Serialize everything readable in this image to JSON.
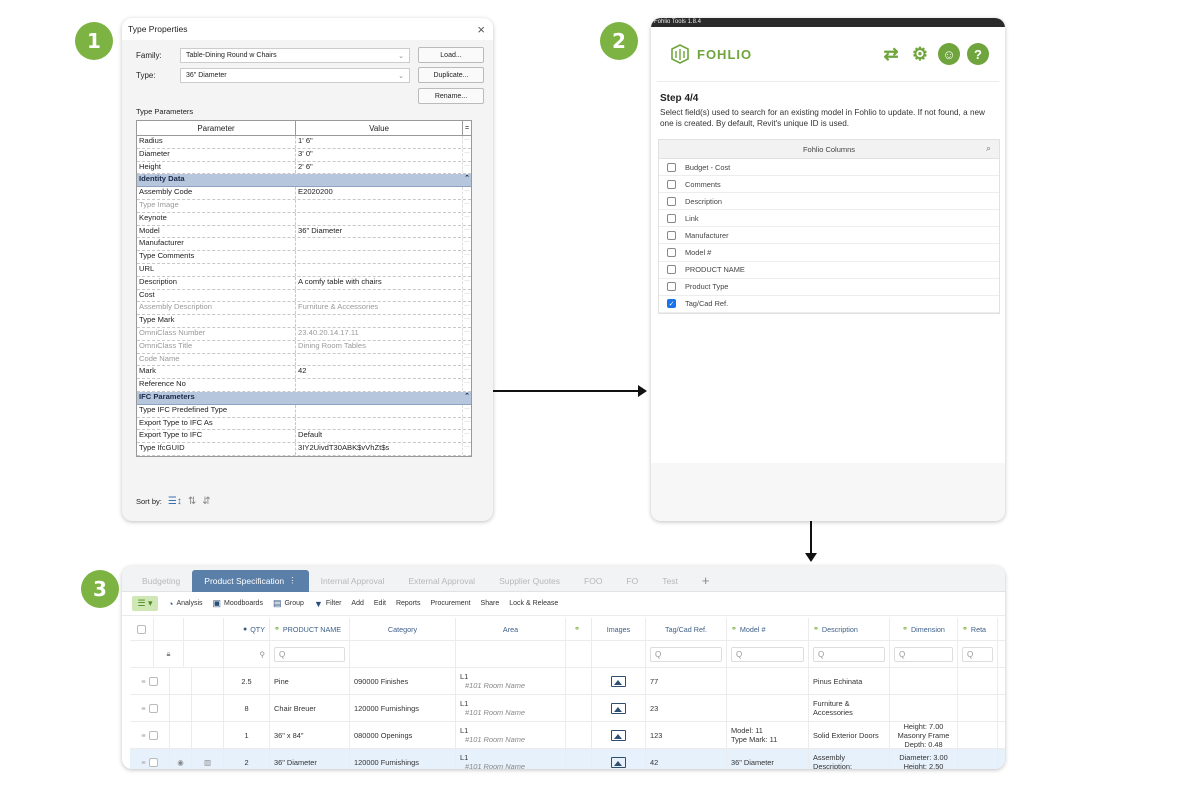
{
  "badges": [
    "1",
    "2",
    "3"
  ],
  "panel1": {
    "title": "Type Properties",
    "close": "×",
    "family_label": "Family:",
    "family_value": "Table-Dining Round w Chairs",
    "type_label": "Type:",
    "type_value": "36\" Diameter",
    "load_button": "Load...",
    "duplicate_button": "Duplicate...",
    "rename_button": "Rename...",
    "section_label": "Type Parameters",
    "col_parameter": "Parameter",
    "col_value": "Value",
    "col_sym": "=",
    "rows": [
      {
        "param": "Radius",
        "value": "1'  6\"",
        "kind": "row"
      },
      {
        "param": "Diameter",
        "value": "3'  0\"",
        "kind": "row"
      },
      {
        "param": "Height",
        "value": "2'  6\"",
        "kind": "row"
      },
      {
        "param": "Identity Data",
        "value": "",
        "kind": "group"
      },
      {
        "param": "Assembly Code",
        "value": "E2020200",
        "kind": "row"
      },
      {
        "param": "Type Image",
        "value": "",
        "kind": "dim"
      },
      {
        "param": "Keynote",
        "value": "",
        "kind": "row"
      },
      {
        "param": "Model",
        "value": "36\" Diameter",
        "kind": "row"
      },
      {
        "param": "Manufacturer",
        "value": "",
        "kind": "row"
      },
      {
        "param": "Type Comments",
        "value": "",
        "kind": "row"
      },
      {
        "param": "URL",
        "value": "",
        "kind": "row"
      },
      {
        "param": "Description",
        "value": "A comfy table with chairs",
        "kind": "row"
      },
      {
        "param": "Cost",
        "value": "",
        "kind": "row"
      },
      {
        "param": "Assembly Description",
        "value": "Furniture & Accessories",
        "kind": "dim"
      },
      {
        "param": "Type Mark",
        "value": "",
        "kind": "row"
      },
      {
        "param": "OmniClass Number",
        "value": "23.40.20.14.17.11",
        "kind": "dim"
      },
      {
        "param": "OmniClass Title",
        "value": "Dining Room Tables",
        "kind": "dim"
      },
      {
        "param": "Code Name",
        "value": "",
        "kind": "dim"
      },
      {
        "param": "Mark",
        "value": "42",
        "kind": "row"
      },
      {
        "param": "Reference No",
        "value": "",
        "kind": "row"
      },
      {
        "param": "IFC Parameters",
        "value": "",
        "kind": "group"
      },
      {
        "param": "Type IFC Predefined Type",
        "value": "",
        "kind": "row"
      },
      {
        "param": "Export Type to IFC As",
        "value": "",
        "kind": "row"
      },
      {
        "param": "Export Type to IFC",
        "value": "Default",
        "kind": "row"
      },
      {
        "param": "Type IfcGUID",
        "value": "3IY2UivdT30ABK$vVhZt$s",
        "kind": "row"
      }
    ],
    "sort_label": "Sort by:"
  },
  "panel2": {
    "titlebar": "Fohlio Tools 1.8.4",
    "logo_text": "FOHLIO",
    "icons": [
      "refresh-icon",
      "gear-icon",
      "user-icon",
      "help-icon"
    ],
    "step": "Step 4/4",
    "description": "Select field(s) used to search for an existing model in Fohlio to update. If not found, a new one is created. By default, Revit's unique ID is used.",
    "list_header": "Fohlio Columns",
    "items": [
      {
        "label": "Budget - Cost",
        "checked": false
      },
      {
        "label": "Comments",
        "checked": false
      },
      {
        "label": "Description",
        "checked": false
      },
      {
        "label": "Link",
        "checked": false
      },
      {
        "label": "Manufacturer",
        "checked": false
      },
      {
        "label": "Model #",
        "checked": false
      },
      {
        "label": "PRODUCT NAME",
        "checked": false
      },
      {
        "label": "Product Type",
        "checked": false
      },
      {
        "label": "Tag/Cad Ref.",
        "checked": true
      }
    ]
  },
  "panel3": {
    "tabs": [
      "Budgeting",
      "Product Specification",
      "Internal Approval",
      "External Approval",
      "Supplier Quotes",
      "FOO",
      "FO",
      "Test",
      "+"
    ],
    "active_tab": "Product Specification",
    "toolbar": {
      "analysis": "Analysis",
      "moodboards": "Moodboards",
      "group": "Group",
      "filter": "Filter",
      "add": "Add",
      "edit": "Edit",
      "reports": "Reports",
      "procurement": "Procurement",
      "share": "Share",
      "lock": "Lock & Release"
    },
    "headers": {
      "qty": "QTY",
      "name": "PRODUCT NAME",
      "category": "Category",
      "area": "Area",
      "images": "Images",
      "tag": "Tag/Cad Ref.",
      "model": "Model #",
      "description": "Description",
      "dimension": "Dimension",
      "retail": "Reta"
    },
    "search_glyph": "Q",
    "rows": [
      {
        "qty": "2.5",
        "name": "Pine",
        "category": "090000 Finishes",
        "area_level": "L1",
        "area_room": "#101 Room Name",
        "tag": "77",
        "model1": "",
        "model2": "",
        "desc1": "Pinus Echinata",
        "desc2": "",
        "dim1": "",
        "dim2": "",
        "dim3": ""
      },
      {
        "qty": "8",
        "name": "Chair Breuer",
        "category": "120000 Furnishings",
        "area_level": "L1",
        "area_room": "#101 Room Name",
        "tag": "23",
        "model1": "",
        "model2": "",
        "desc1": "Furniture &",
        "desc2": "Accessories",
        "dim1": "",
        "dim2": "",
        "dim3": ""
      },
      {
        "qty": "1",
        "name": "36\" x 84\"",
        "category": "080000 Openings",
        "area_level": "L1",
        "area_room": "#101 Room Name",
        "tag": "123",
        "model1": "Model: 11",
        "model2": "Type Mark: 11",
        "desc1": "Solid Exterior Doors",
        "desc2": "",
        "dim1": "Height: 7.00",
        "dim2": "Masonry Frame",
        "dim3": "Depth: 0.48"
      },
      {
        "qty": "2",
        "name": "36\" Diameter",
        "category": "120000 Furnishings",
        "area_level": "L1",
        "area_room": "#101 Room Name",
        "tag": "42",
        "model1": "36\" Diameter",
        "model2": "",
        "desc1": "Assembly",
        "desc2": "Description:",
        "dim1": "Diameter: 3.00",
        "dim2": "Height: 2.50",
        "dim3": ""
      }
    ]
  }
}
